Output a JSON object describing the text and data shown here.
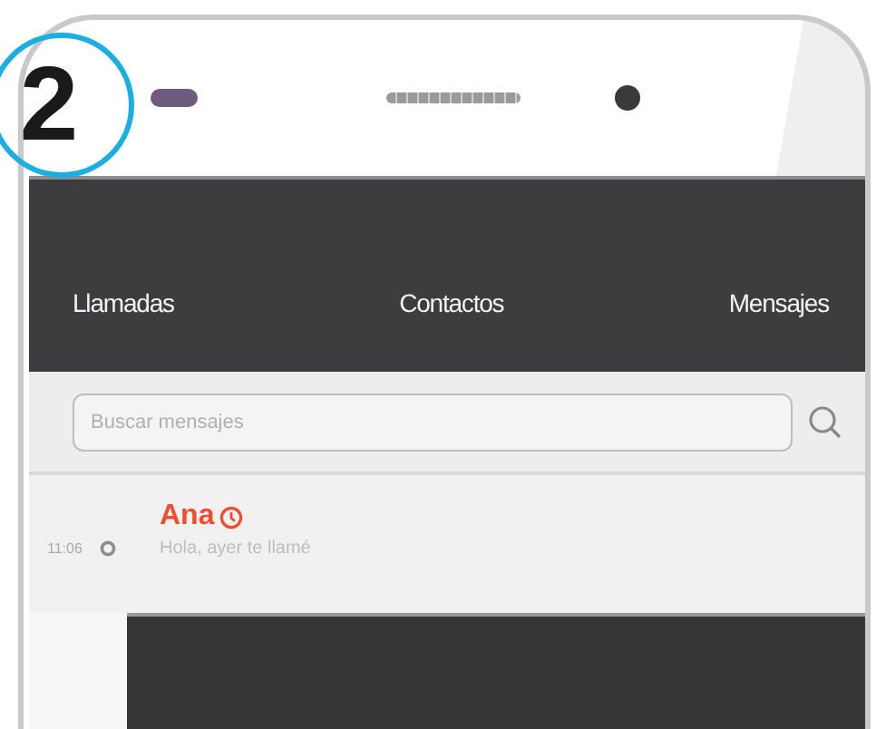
{
  "step_badge": "2",
  "tabs": [
    {
      "label": "Llamadas"
    },
    {
      "label": "Contactos"
    },
    {
      "label": "Mensajes"
    }
  ],
  "search": {
    "placeholder": "Buscar mensajes"
  },
  "messages": [
    {
      "time": "11:06",
      "name": "Ana",
      "preview": "Hola, ayer te llamé"
    }
  ]
}
